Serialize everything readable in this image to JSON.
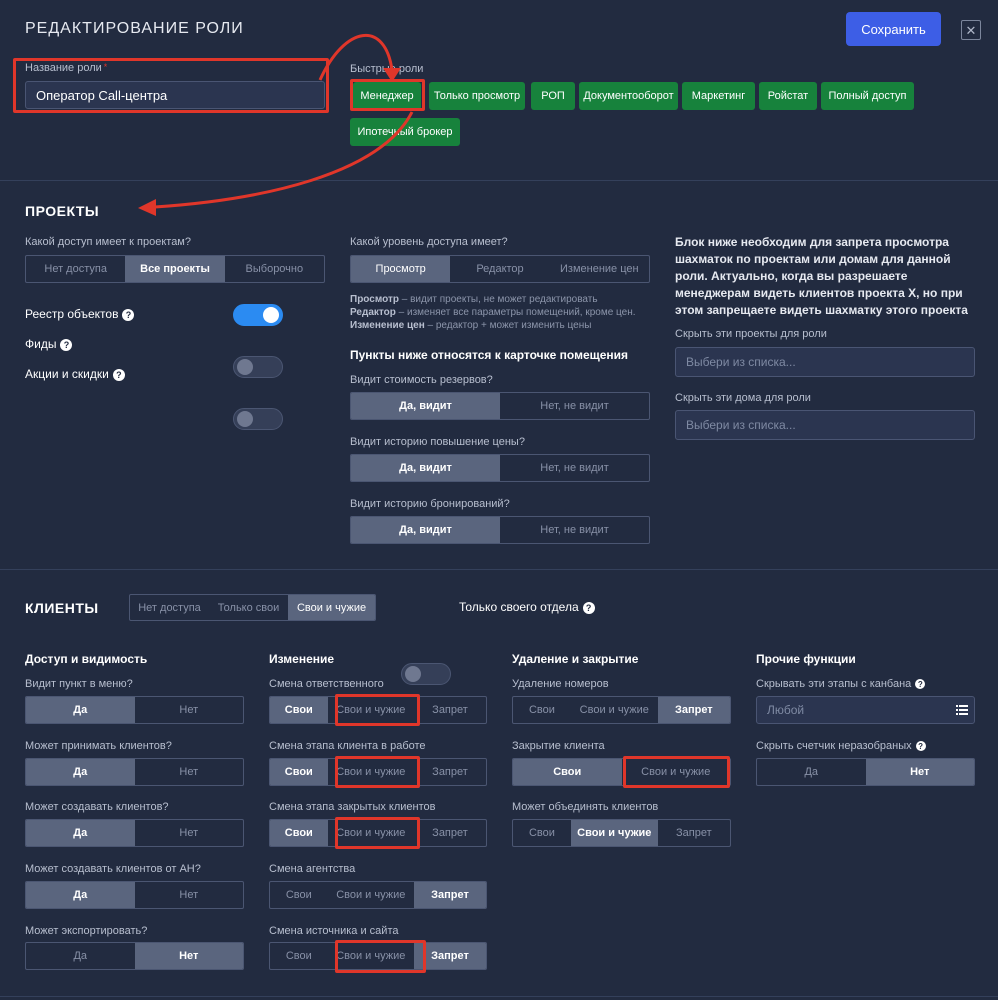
{
  "header": {
    "title": "РЕДАКТИРОВАНИЕ РОЛИ",
    "save_label": "Сохранить",
    "close_glyph": "✕"
  },
  "role": {
    "label": "Название роли",
    "required_mark": "*",
    "value": "Оператор Call-центра"
  },
  "quick_roles": {
    "label": "Быстрые роли",
    "items": [
      "Менеджер",
      "Только просмотр",
      "РОП",
      "Документооборот",
      "Маркетинг",
      "Ройстат",
      "Полный доступ",
      "Ипотечный брокер"
    ]
  },
  "projects": {
    "heading": "ПРОЕКТЫ",
    "access_q": "Какой доступ имеет к проектам?",
    "access_options": [
      "Нет доступа",
      "Все проекты",
      "Выборочно"
    ],
    "access_selected": "Все проекты",
    "switches": [
      {
        "label": "Реестр объектов",
        "on": true
      },
      {
        "label": "Фиды",
        "on": false
      },
      {
        "label": "Акции и скидки",
        "on": false
      }
    ],
    "level_q": "Какой уровень доступа имеет?",
    "level_options": [
      "Просмотр",
      "Редактор",
      "Изменение цен"
    ],
    "level_selected": "Просмотр",
    "level_desc": [
      {
        "term": "Просмотр",
        "text": " – видит проекты, не может редактировать"
      },
      {
        "term": "Редактор",
        "text": " – изменяет все параметры помещений, кроме цен."
      },
      {
        "term": "Изменение цен",
        "text": " – редактор + может изменить цены"
      }
    ],
    "card_heading": "Пункты ниже относятся к карточке помещения",
    "card_questions": [
      {
        "q": "Видит стоимость резервов?",
        "options": [
          "Да, видит",
          "Нет, не видит"
        ],
        "selected": "Да, видит"
      },
      {
        "q": "Видит историю повышение цены?",
        "options": [
          "Да, видит",
          "Нет, не видит"
        ],
        "selected": "Да, видит"
      },
      {
        "q": "Видит историю бронирований?",
        "options": [
          "Да, видит",
          "Нет, не видит"
        ],
        "selected": "Да, видит"
      }
    ],
    "info": "Блок ниже необходим для запрета просмотра шахматок по проектам или домам для данной роли. Актуально, когда вы разрешаете менеджерам видеть клиентов проекта Х, но при этом запрещаете видеть шахматку этого проекта",
    "hide_projects_label": "Скрыть эти проекты для роли",
    "hide_projects_placeholder": "Выбери из списка...",
    "hide_houses_label": "Скрыть эти дома для роли",
    "hide_houses_placeholder": "Выбери из списка..."
  },
  "clients": {
    "heading": "КЛИЕНТЫ",
    "scope_options": [
      "Нет доступа",
      "Только свои",
      "Свои и чужие"
    ],
    "scope_selected": "Свои и чужие",
    "own_dept_label": "Только своего отдела",
    "own_dept_on": false,
    "col1": {
      "heading": "Доступ и видимость",
      "items": [
        {
          "q": "Видит пункт в меню?",
          "options": [
            "Да",
            "Нет"
          ],
          "selected": "Да"
        },
        {
          "q": "Может принимать клиентов?",
          "options": [
            "Да",
            "Нет"
          ],
          "selected": "Да"
        },
        {
          "q": "Может создавать клиентов?",
          "options": [
            "Да",
            "Нет"
          ],
          "selected": "Да"
        },
        {
          "q": "Может создавать клиентов от АН?",
          "options": [
            "Да",
            "Нет"
          ],
          "selected": "Да"
        },
        {
          "q": "Может экспортировать?",
          "options": [
            "Да",
            "Нет"
          ],
          "selected": "Нет"
        }
      ]
    },
    "col2": {
      "heading": "Изменение",
      "items": [
        {
          "q": "Смена ответственного",
          "options": [
            "Свои",
            "Свои и чужие",
            "Запрет"
          ],
          "selected": "Свои"
        },
        {
          "q": "Смена этапа клиента в работе",
          "options": [
            "Свои",
            "Свои и чужие",
            "Запрет"
          ],
          "selected": "Свои"
        },
        {
          "q": "Смена этапа закрытых клиентов",
          "options": [
            "Свои",
            "Свои и чужие",
            "Запрет"
          ],
          "selected": "Свои"
        },
        {
          "q": "Смена агентства",
          "options": [
            "Свои",
            "Свои и чужие",
            "Запрет"
          ],
          "selected": "Запрет"
        },
        {
          "q": "Смена источника и сайта",
          "options": [
            "Свои",
            "Свои и чужие",
            "Запрет"
          ],
          "selected": "Запрет"
        }
      ]
    },
    "col3": {
      "heading": "Удаление и закрытие",
      "items": [
        {
          "q": "Удаление номеров",
          "options": [
            "Свои",
            "Свои и чужие",
            "Запрет"
          ],
          "selected": "Запрет"
        },
        {
          "q": "Закрытие клиента",
          "options": [
            "Свои",
            "Свои и чужие"
          ],
          "selected": "Свои"
        },
        {
          "q": "Может объединять клиентов",
          "options": [
            "Свои",
            "Свои и чужие",
            "Запрет"
          ],
          "selected": "Свои и чужие"
        }
      ]
    },
    "col4": {
      "heading": "Прочие функции",
      "kanban_label": "Скрывать эти этапы с канбана",
      "kanban_placeholder": "Любой",
      "counter_label": "Скрыть счетчик неразобраных",
      "counter_options": [
        "Да",
        "Нет"
      ],
      "counter_selected": "Нет"
    },
    "help_glyph": "?"
  },
  "colors": {
    "background": "#222b40",
    "accent": "#3d5ee6",
    "quick_role": "#17823c",
    "highlight": "#e0362a",
    "toggle_on": "#2b8bf2"
  }
}
